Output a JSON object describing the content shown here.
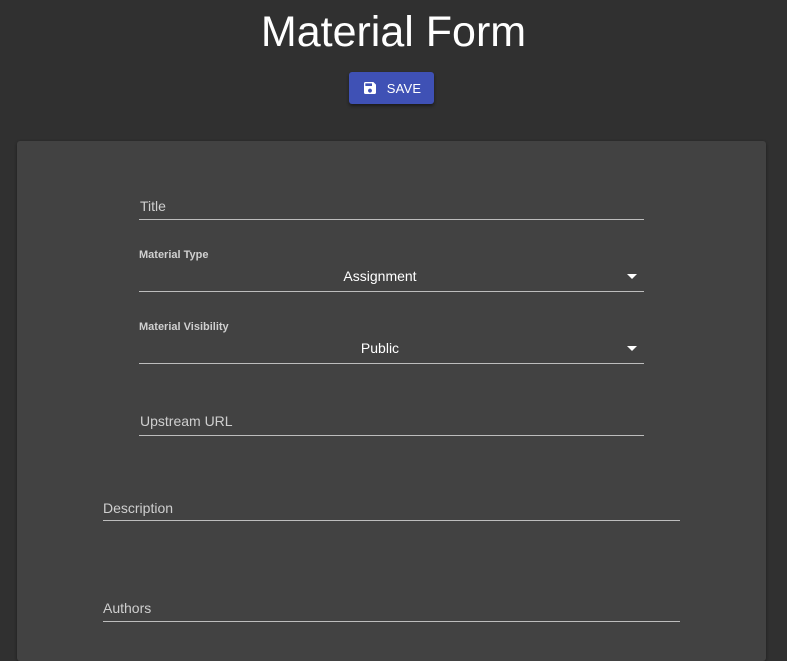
{
  "page": {
    "title": "Material Form"
  },
  "toolbar": {
    "save_label": "SAVE",
    "save_icon": "floppy-disk-icon",
    "accent_color": "#3f51b5"
  },
  "form": {
    "title_field": {
      "placeholder": "Title",
      "value": ""
    },
    "material_type": {
      "label": "Material Type",
      "value": "Assignment",
      "icon": "dropdown-arrow-icon"
    },
    "material_visibility": {
      "label": "Material Visibility",
      "value": "Public",
      "icon": "dropdown-arrow-icon"
    },
    "upstream_url": {
      "placeholder": "Upstream URL",
      "value": ""
    },
    "description": {
      "placeholder": "Description",
      "value": ""
    },
    "authors": {
      "placeholder": "Authors",
      "value": ""
    }
  }
}
